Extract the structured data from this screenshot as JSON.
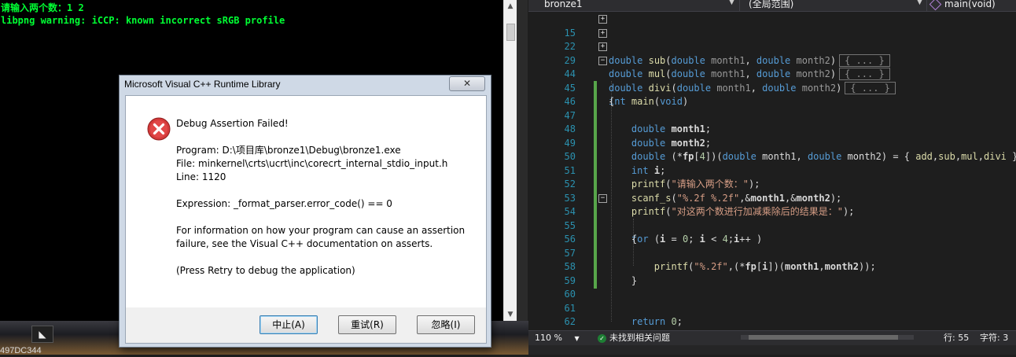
{
  "console": {
    "lines": [
      "请输入两个数：1 2",
      "libpng warning: iCCP: known incorrect sRGB profile"
    ]
  },
  "taskbar": {
    "text": "497DC344"
  },
  "dialog": {
    "title": "Microsoft Visual C++ Runtime Library",
    "close_label": "✕",
    "heading": "Debug Assertion Failed!",
    "program": "Program: D:\\项目库\\bronze1\\Debug\\bronze1.exe",
    "file": "File: minkernel\\crts\\ucrt\\inc\\corecrt_internal_stdio_input.h",
    "line": "Line: 1120",
    "expression": "Expression: _format_parser.error_code() == 0",
    "info1": "For information on how your program can cause an assertion",
    "info2": "failure, see the Visual C++ documentation on asserts.",
    "retry_hint": "(Press Retry to debug the application)",
    "buttons": {
      "abort": "中止(A)",
      "retry": "重试(R)",
      "ignore": "忽略(I)"
    }
  },
  "editor": {
    "nav": {
      "project": "bronze1",
      "scope": "(全局范围)",
      "member": "main(void)"
    },
    "line_numbers": [
      "15",
      "22",
      "29",
      "44",
      "45",
      "46",
      "47",
      "48",
      "49",
      "50",
      "51",
      "52",
      "53",
      "54",
      "55",
      "56",
      "57",
      "58",
      "59",
      "60",
      "61",
      "62"
    ],
    "collapsed_marker": "{ ... }",
    "status": {
      "zoom": "110 %",
      "issues": "未找到相关问题",
      "row": "行: 55",
      "col": "字符: 3"
    }
  },
  "colors": {
    "keyword": "#569cd6",
    "function": "#dcdcaa",
    "string": "#d69d85",
    "line_number": "#2b91af",
    "console_text": "#00ff33",
    "change_bar": "#57a64a"
  }
}
